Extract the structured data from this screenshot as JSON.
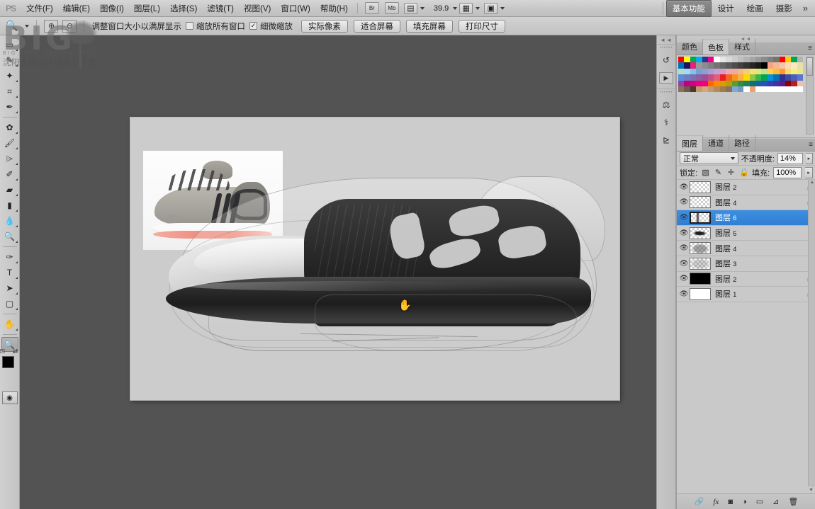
{
  "app": {
    "logo": "PS"
  },
  "menubar": {
    "items": [
      {
        "label": "文件(F)"
      },
      {
        "label": "编辑(E)"
      },
      {
        "label": "图像(I)"
      },
      {
        "label": "图层(L)"
      },
      {
        "label": "选择(S)"
      },
      {
        "label": "滤镜(T)"
      },
      {
        "label": "视图(V)"
      },
      {
        "label": "窗口(W)"
      },
      {
        "label": "帮助(H)"
      }
    ],
    "bridge_label": "Br",
    "minibridge_label": "Mb",
    "view_extras_icon": "screen-mode-icon",
    "zoom_level": "39.9",
    "arrange_icon": "arrange-documents-icon",
    "screenmode_icon": "screen-mode-icon"
  },
  "workspace": {
    "tabs": [
      {
        "label": "基本功能",
        "active": true
      },
      {
        "label": "设计",
        "active": false
      },
      {
        "label": "绘画",
        "active": false
      },
      {
        "label": "摄影",
        "active": false
      }
    ],
    "more": "»"
  },
  "optionsbar": {
    "tool_icon": "zoom-tool-icon",
    "preset_icon": "tool-preset-icon",
    "zoom_in_icon": "zoom-in-icon",
    "zoom_out_icon": "zoom-out-icon",
    "resize_windows_label": "调整窗口大小以满屏显示",
    "zoom_all_windows": {
      "label": "缩放所有窗口",
      "checked": false
    },
    "scrubby_zoom": {
      "label": "细微缩放",
      "checked": true,
      "mark": "✓"
    },
    "buttons": [
      {
        "label": "实际像素"
      },
      {
        "label": "适合屏幕"
      },
      {
        "label": "填充屏幕"
      },
      {
        "label": "打印尺寸"
      }
    ]
  },
  "watermark": {
    "big": "BIG",
    "sub": "BIG TREE DESIGN STUDIO",
    "cn": "沈阳大树设计培训工作室"
  },
  "toolbar": {
    "tools": [
      {
        "name": "marquee-tool",
        "glyph": "▭",
        "sub": true,
        "selected": false
      },
      {
        "name": "lasso-tool",
        "glyph": "✎",
        "sub": true,
        "selected": false
      },
      {
        "name": "magic-wand-tool",
        "glyph": "✦",
        "sub": true,
        "selected": false
      },
      {
        "name": "crop-tool",
        "glyph": "⌗",
        "sub": true,
        "selected": false
      },
      {
        "name": "eyedropper-tool",
        "glyph": "✒",
        "sub": true,
        "selected": false
      },
      {
        "name": "healing-brush-tool",
        "glyph": "✿",
        "sub": true,
        "selected": false
      },
      {
        "name": "brush-tool",
        "glyph": "🖌",
        "sub": true,
        "selected": false
      },
      {
        "name": "clone-stamp-tool",
        "glyph": "⌲",
        "sub": true,
        "selected": false
      },
      {
        "name": "history-brush-tool",
        "glyph": "✐",
        "sub": true,
        "selected": false
      },
      {
        "name": "eraser-tool",
        "glyph": "▰",
        "sub": true,
        "selected": false
      },
      {
        "name": "gradient-tool",
        "glyph": "▮",
        "sub": true,
        "selected": false
      },
      {
        "name": "blur-tool",
        "glyph": "💧",
        "sub": true,
        "selected": false
      },
      {
        "name": "dodge-tool",
        "glyph": "🔍",
        "sub": true,
        "selected": false
      },
      {
        "name": "pen-tool",
        "glyph": "✑",
        "sub": true,
        "selected": false
      },
      {
        "name": "type-tool",
        "glyph": "T",
        "sub": true,
        "selected": false
      },
      {
        "name": "path-selection-tool",
        "glyph": "➤",
        "sub": true,
        "selected": false
      },
      {
        "name": "rectangle-shape-tool",
        "glyph": "▢",
        "sub": true,
        "selected": false
      },
      {
        "name": "hand-tool",
        "glyph": "✋",
        "sub": true,
        "selected": false
      },
      {
        "name": "zoom-tool",
        "glyph": "🔍",
        "sub": false,
        "selected": true
      }
    ],
    "foreground_color": "#000000",
    "background_color": "#ffffff",
    "quickmask_icon": "quick-mask-icon"
  },
  "canvas": {
    "background_color": "#535353",
    "document_color": "#cccccc",
    "cursor": "hand-cursor",
    "reference_photo_name": "adidas-running-shoe-reference",
    "sketch_name": "shoe-concept-sketch"
  },
  "icondock": {
    "groups": [
      [
        {
          "name": "history-panel-icon",
          "glyph": "↺"
        },
        {
          "name": "actions-panel-icon",
          "glyph": "▶"
        }
      ],
      [
        {
          "name": "adjustments-panel-icon",
          "glyph": "⚖"
        },
        {
          "name": "styles-panel-icon",
          "glyph": "✤"
        },
        {
          "name": "masks-panel-icon",
          "glyph": "◫"
        }
      ]
    ]
  },
  "swatches_panel": {
    "tabs": [
      {
        "label": "颜色",
        "active": false
      },
      {
        "label": "色板",
        "active": true
      },
      {
        "label": "样式",
        "active": false
      }
    ],
    "menu_icon": "panel-menu-icon",
    "colors": [
      "#ff0000",
      "#ffff00",
      "#00a651",
      "#00aeef",
      "#2e3192",
      "#ec008c",
      "#ffffff",
      "#e6e6e6",
      "#d9d9d9",
      "#cccccc",
      "#bfbfbf",
      "#b3b3b3",
      "#a6a6a6",
      "#999999",
      "#8c8c8c",
      "#808080",
      "#737373",
      "#ff0000",
      "#ffcc00",
      "#00a651",
      "#b3b3b3",
      "#0072bc",
      "#1b1464",
      "#ed1e79",
      "#999999",
      "#8c8c8c",
      "#808080",
      "#737373",
      "#666666",
      "#595959",
      "#4d4d4d",
      "#404040",
      "#333333",
      "#262626",
      "#1a1a1a",
      "#000000",
      "#f7a383",
      "#f5b795",
      "#f2c6a8",
      "#ffd9b3",
      "#ffe6c2",
      "#e8e0a8",
      "#b8dcc8",
      "#a8d8ea",
      "#7fc4e8",
      "#7b9fd4",
      "#8e9ed4",
      "#a89ed4",
      "#c49ed4",
      "#d49ec4",
      "#e8a8b8",
      "#f2a89a",
      "#f2b98a",
      "#f5cc7a",
      "#f5e07a",
      "#e0e87a",
      "#c4e08a",
      "#ffd24d",
      "#ffbb33",
      "#ff9933",
      "#f2e06a",
      "#f5f07a",
      "#e8e88a",
      "#5b8fd4",
      "#6b7fc4",
      "#7b6fb4",
      "#8b5fa4",
      "#9b4f94",
      "#c44f84",
      "#e0607a",
      "#ed1c24",
      "#f26522",
      "#f7941e",
      "#fbb040",
      "#ffd800",
      "#8dc63f",
      "#39b54a",
      "#00a651",
      "#0095da",
      "#0072bc",
      "#2e3192",
      "#3b4ba8",
      "#4a5fc0",
      "#5b74d4",
      "#8e44ad",
      "#c0007f",
      "#d4007f",
      "#e8007f",
      "#f2007f",
      "#ff6600",
      "#ff8c00",
      "#d4a000",
      "#b8a000",
      "#5a9e2f",
      "#2f8f3f",
      "#1f7f5f",
      "#0e6f7f",
      "#1a5f9f",
      "#2a4fbf",
      "#3a3faf",
      "#4a2f9f",
      "#5a1f8f",
      "#8b0000",
      "#b22222",
      "#e8c4a8",
      "#8b6f5a",
      "#6f5a4a",
      "#4a3a2a",
      "#c49a6c",
      "#d4aa7c",
      "#c49a6c",
      "#b48a5c",
      "#a47a4c",
      "#8b6f5a",
      "#7fa8d4",
      "#6f98c4",
      "#ffffff",
      "#f2a06a",
      "#ffffff",
      "#ffffff",
      "#ffffff",
      "#ffffff",
      "#ffffff",
      "#ffffff",
      "#ffffff",
      "#ffffff"
    ],
    "new_swatch_icon": "new-swatch-icon",
    "delete_swatch_icon": "delete-swatch-icon"
  },
  "layers_panel": {
    "tabs": [
      {
        "label": "图层",
        "active": true
      },
      {
        "label": "通道",
        "active": false
      },
      {
        "label": "路径",
        "active": false
      }
    ],
    "menu_icon": "panel-menu-icon",
    "blend_mode": "正常",
    "opacity_label": "不透明度:",
    "opacity_value": "14%",
    "lock_label": "锁定:",
    "lock_icons": [
      {
        "name": "lock-transparent-pixels-icon",
        "glyph": "▧"
      },
      {
        "name": "lock-image-pixels-icon",
        "glyph": "✎"
      },
      {
        "name": "lock-position-icon",
        "glyph": "✛"
      },
      {
        "name": "lock-all-icon",
        "glyph": "🔒"
      }
    ],
    "fill_label": "填充:",
    "fill_value": "100%",
    "layers": [
      {
        "name": "图层",
        "num": "2",
        "visible": true,
        "selected": false,
        "locked": true,
        "thumb": "transparent"
      },
      {
        "name": "图层",
        "num": "4",
        "visible": true,
        "selected": false,
        "locked": true,
        "thumb": "transparent"
      },
      {
        "name": "图层",
        "num": "6",
        "visible": true,
        "selected": true,
        "locked": false,
        "thumb": "sketch-small"
      },
      {
        "name": "图层",
        "num": "5",
        "visible": true,
        "selected": false,
        "locked": false,
        "thumb": "sketch-dark"
      },
      {
        "name": "图层",
        "num": "4",
        "visible": true,
        "selected": false,
        "locked": false,
        "thumb": "sketch-line"
      },
      {
        "name": "图层",
        "num": "3",
        "visible": true,
        "selected": false,
        "locked": false,
        "thumb": "sketch-faint"
      },
      {
        "name": "图层",
        "num": "2",
        "visible": true,
        "selected": false,
        "locked": true,
        "thumb": "black"
      },
      {
        "name": "图层",
        "num": "1",
        "visible": true,
        "selected": false,
        "locked": true,
        "thumb": "white"
      }
    ],
    "eye_glyph": "👁",
    "lock_glyph": "🔒",
    "footer_icons": [
      {
        "name": "link-layers-icon",
        "glyph": "🔗"
      },
      {
        "name": "layer-style-icon",
        "glyph": "fx"
      },
      {
        "name": "layer-mask-icon",
        "glyph": "◙"
      },
      {
        "name": "adjustment-layer-icon",
        "glyph": "◒"
      },
      {
        "name": "new-group-icon",
        "glyph": "▭"
      },
      {
        "name": "new-layer-icon",
        "glyph": "⊿"
      },
      {
        "name": "delete-layer-icon",
        "glyph": "🗑"
      }
    ]
  }
}
